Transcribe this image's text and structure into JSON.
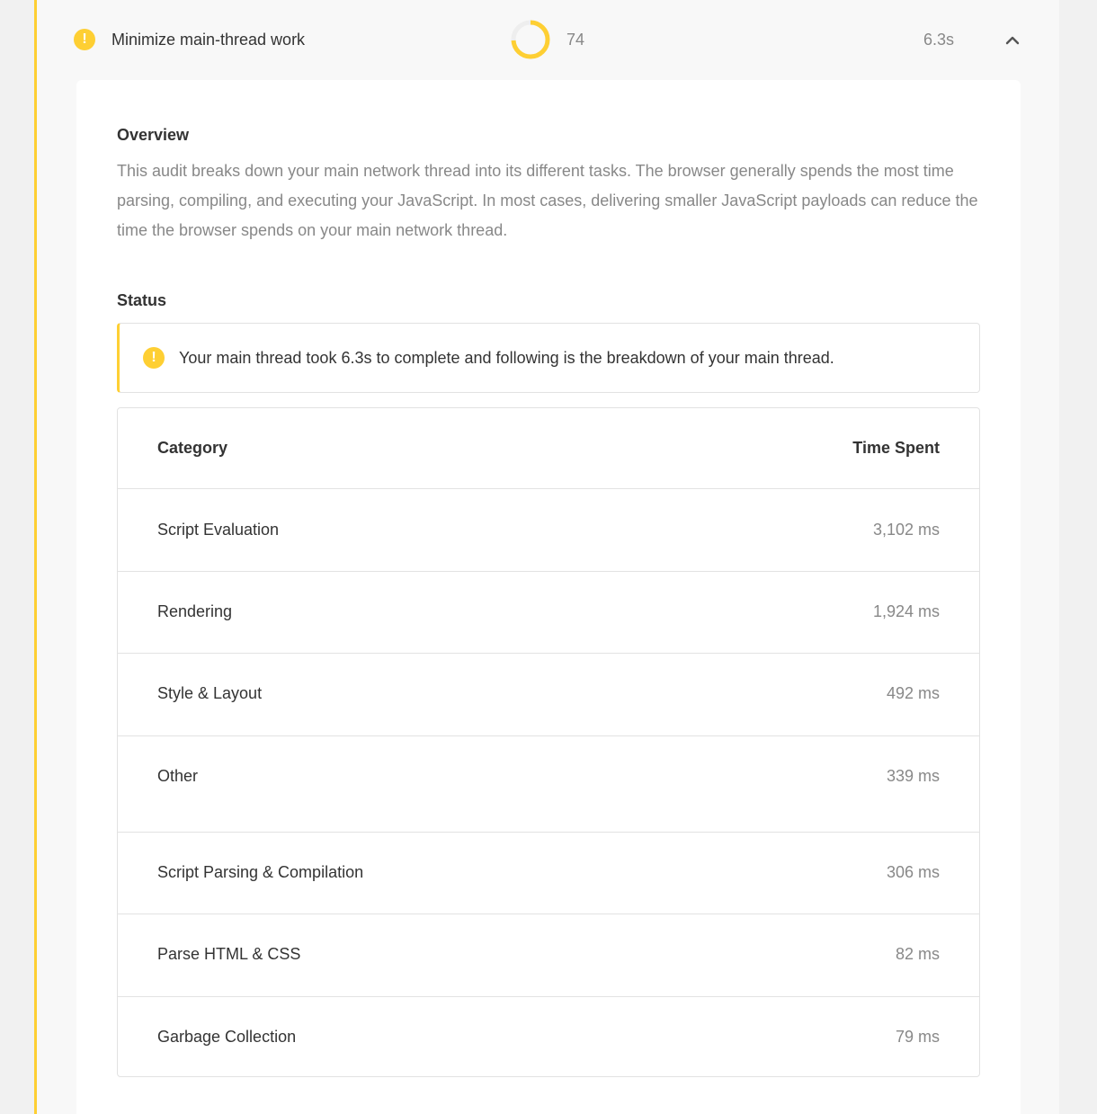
{
  "audit": {
    "title": "Minimize main-thread work",
    "score": "74",
    "score_fraction": 0.74,
    "time": "6.3s",
    "accent_color": "#fecf33",
    "status_icon": "warning-icon",
    "toggle_icon": "chevron-up-icon"
  },
  "overview": {
    "heading": "Overview",
    "text": "This audit breaks down your main network thread into its different tasks. The browser generally spends the most time parsing, compiling, and executing your JavaScript. In most cases, delivering smaller JavaScript payloads can reduce the time the browser spends on your main network thread."
  },
  "status": {
    "heading": "Status",
    "message": "Your main thread took 6.3s to complete and following is the breakdown of your main thread."
  },
  "table": {
    "headers": {
      "category": "Category",
      "time": "Time Spent"
    },
    "rows": [
      {
        "category": "Script Evaluation",
        "time": "3,102 ms"
      },
      {
        "category": "Rendering",
        "time": "1,924 ms"
      },
      {
        "category": "Style & Layout",
        "time": "492 ms"
      },
      {
        "category": "Other",
        "time": "339 ms"
      },
      {
        "category": "Script Parsing & Compilation",
        "time": "306 ms"
      },
      {
        "category": "Parse HTML & CSS",
        "time": "82 ms"
      },
      {
        "category": "Garbage Collection",
        "time": "79 ms"
      }
    ]
  }
}
